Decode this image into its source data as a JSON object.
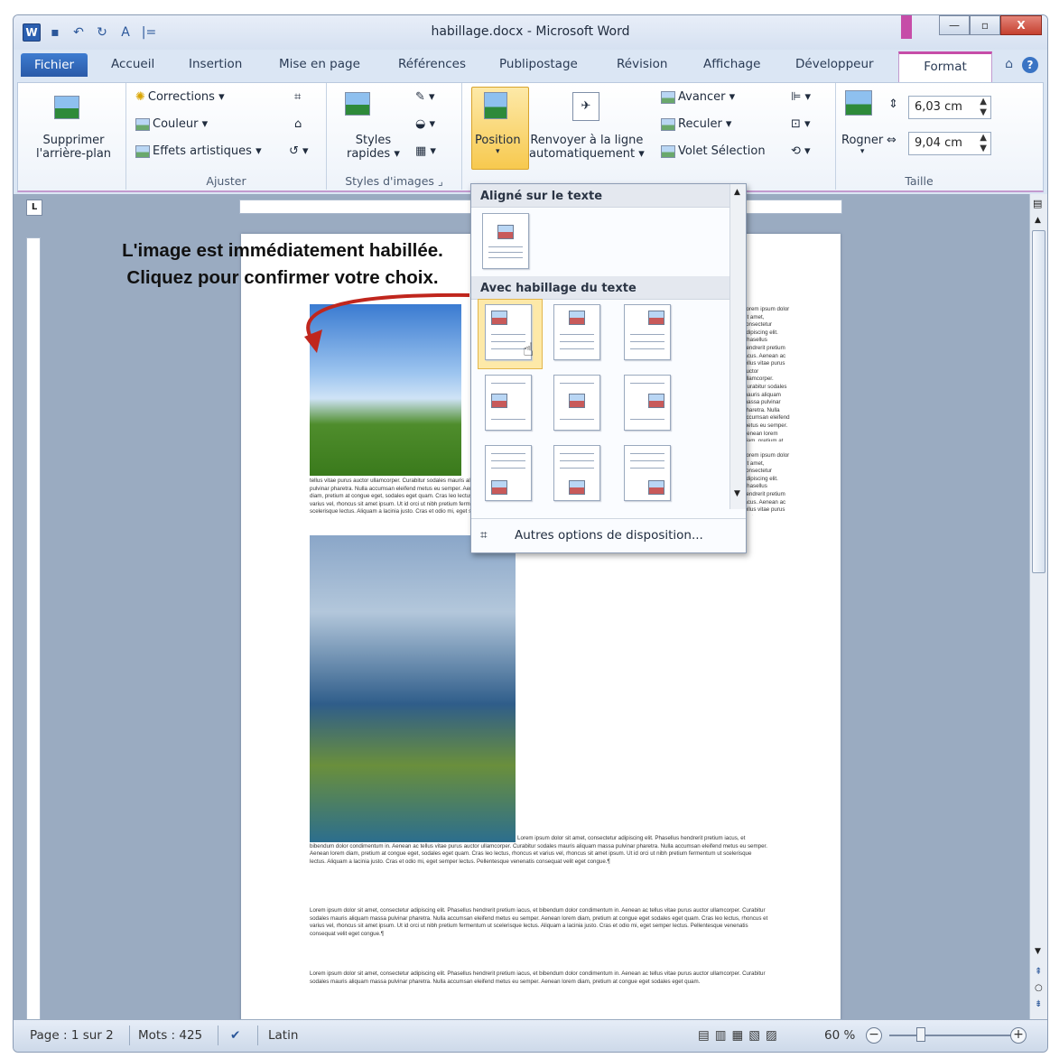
{
  "window": {
    "title": "habillage.docx - Microsoft Word",
    "controls": {
      "minimize": "—",
      "maximize": "▫",
      "close": "X"
    }
  },
  "qat": {
    "undo_icon": "↶",
    "redo_icon": "↻",
    "font_icon": "A",
    "more_icon": "|="
  },
  "tabs": [
    "Fichier",
    "Accueil",
    "Insertion",
    "Mise en page",
    "Références",
    "Publipostage",
    "Révision",
    "Affichage",
    "Développeur",
    "Format"
  ],
  "ribbon": {
    "remove_bg": [
      "Supprimer",
      "l'arrière-plan"
    ],
    "corrections": "Corrections",
    "couleur": "Couleur",
    "effets": "Effets artistiques",
    "ajuster_label": "Ajuster",
    "styles_rapides": [
      "Styles",
      "rapides"
    ],
    "styles_label": "Styles d'images",
    "position": "Position",
    "renvoyer": [
      "Renvoyer à la ligne",
      "automatiquement"
    ],
    "avancer": "Avancer",
    "reculer": "Reculer",
    "volet": "Volet Sélection",
    "rogner": "Rogner",
    "height_value": "6,03 cm",
    "width_value": "9,04 cm",
    "taille_label": "Taille"
  },
  "dropdown": {
    "section1": "Aligné sur le texte",
    "section2": "Avec habillage du texte",
    "footer": "Autres options de disposition..."
  },
  "document": {
    "annotation_line1": "L'image est immédiatement habillée.",
    "annotation_line2": "Cliquez pour confirmer votre choix.",
    "lorem_short": "tellus vitae purus auctor ullamcorper. Curabitur sodales mauris aliquam massa pulvinar pharetra. Nulla accumsan eleifend metus eu semper. Aenean lorem diam, pretium at congue eget, sodales eget quam. Cras leo lectus, rhoncus et varius vel, rhoncus sit amet ipsum. Ut id orci ut nibh pretium fermentum ut scelerisque lectus. Aliquam a lacinia justo. Cras et odio mi, eget semper lectus.",
    "lorem_right": "Lorem ipsum dolor sit amet, consectetur adipiscing elit. Phasellus hendrerit pretium iacus. Aenean ac tellus vitae purus auctor ullamcorper. Curabitur sodales mauris aliquam massa pulvinar pharetra. Nulla accumsan eleifend metus eu semper. Aenean lorem diam, pretium at congue eget, sodales eget quam. Cras leo lectus, rhoncus et varius vel. Ut id orci ut nibh pretium fermentum ut scelerisque lectus. Aliquam a lacinia justo. Cras et odio mi, eget semper lectus. Pellentesque venenatis consequat velit eget congue.",
    "lorem_para1": "Lorem ipsum dolor sit amet, consectetur adipiscing elit. Phasellus hendrerit pretium iacus, et bibendum dolor condimentum in. Aenean ac tellus vitae purus auctor ullamcorper. Curabitur sodales mauris aliquam massa pulvinar pharetra. Nulla accumsan eleifend metus eu semper. Aenean lorem diam, pretium at congue eget, sodales eget quam. Cras leo lectus, rhoncus et varius vel, rhoncus sit amet ipsum. Ut id orci ut nibh pretium fermentum ut scelerisque lectus. Aliquam a lacinia justo. Cras et odio mi, eget semper lectus. Pellentesque venenatis consequat velit eget congue.¶",
    "lorem_para2": "Lorem ipsum dolor sit amet, consectetur adipiscing elit. Phasellus hendrerit pretium iacus, et bibendum dolor condimentum in. Aenean ac tellus vitae purus auctor ullamcorper. Curabitur sodales mauris aliquam massa pulvinar pharetra. Nulla accumsan eleifend metus eu semper. Aenean lorem diam, pretium at congue eget sodales eget quam. Cras leo lectus, rhoncus et varius vel, rhoncus sit amet ipsum. Ut id orci ut nibh pretium fermentum ut scelerisque lectus. Aliquam a lacinia justo. Cras et odio mi, eget semper lectus. Pellentesque venenatis consequat velit eget congue.¶",
    "lorem_para3": "Lorem ipsum dolor sit amet, consectetur adipiscing elit. Phasellus hendrerit pretium iacus, et bibendum dolor condimentum in. Aenean ac tellus vitae purus auctor ullamcorper. Curabitur sodales mauris aliquam massa pulvinar pharetra. Nulla accumsan eleifend metus eu semper. Aenean lorem diam, pretium at congue eget sodales eget quam."
  },
  "status": {
    "page": "Page : 1 sur 2",
    "words": "Mots : 425",
    "lang": "Latin",
    "zoom": "60 %",
    "zoom_level": 0.6
  },
  "colors": {
    "accent": "#c64da8",
    "selected": "#fde9a8",
    "file_tab": "#2a5aa8"
  }
}
